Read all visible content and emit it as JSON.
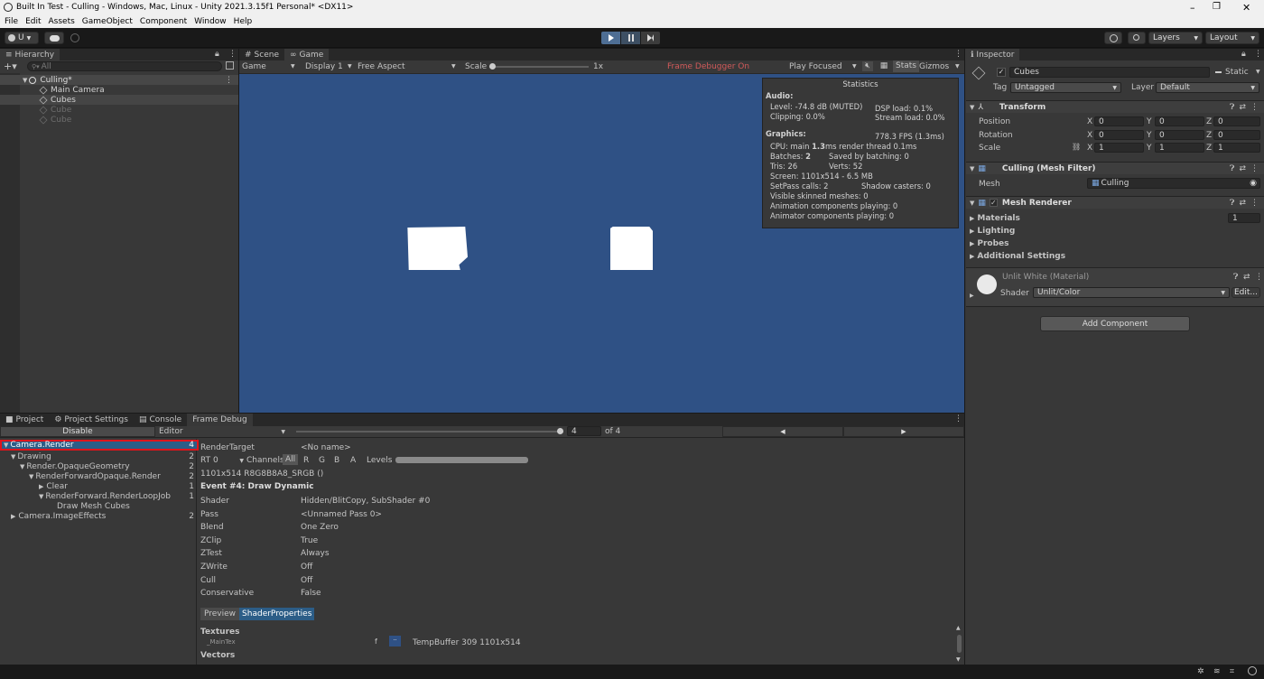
{
  "window": {
    "title": "Built In Test - Culling - Windows, Mac, Linux - Unity 2021.3.15f1 Personal* <DX11>",
    "controls": [
      "–",
      "❐",
      "✕"
    ]
  },
  "menu": [
    "File",
    "Edit",
    "Assets",
    "GameObject",
    "Component",
    "Window",
    "Help"
  ],
  "toolbar": {
    "account": "U",
    "layers": "Layers",
    "layout": "Layout"
  },
  "hierarchy": {
    "tab": "Hierarchy",
    "search_placeholder": "All",
    "scene": "Culling*",
    "items": [
      {
        "label": "Main Camera",
        "active": true
      },
      {
        "label": "Cubes",
        "active": true
      },
      {
        "label": "Cube",
        "active": false
      },
      {
        "label": "Cube",
        "active": false
      }
    ]
  },
  "scene_tabs": {
    "scene": "Scene",
    "game": "Game",
    "game_bar": {
      "mode": "Game",
      "display": "Display 1",
      "aspect": "Free Aspect",
      "scale_label": "Scale",
      "scale_value": "1x",
      "frame_debugger": "Frame Debugger On",
      "play_focused": "Play Focused",
      "stats": "Stats",
      "gizmos": "Gizmos"
    }
  },
  "stats": {
    "title": "Statistics",
    "audio_header": "Audio:",
    "level": "Level: -74.8 dB (MUTED)",
    "dsp": "DSP load: 0.1%",
    "clipping": "Clipping: 0.0%",
    "stream": "Stream load: 0.0%",
    "graphics_header": "Graphics:",
    "fps": "778.3 FPS (1.3ms)",
    "cpu_prefix": "CPU: main ",
    "cpu_main": "1.3",
    "cpu_suffix": "ms  render thread 0.1ms",
    "batches_prefix": "Batches: ",
    "batches": "2",
    "saved": "Saved by batching: 0",
    "tris": "Tris: 26",
    "verts": "Verts: 52",
    "screen": "Screen: 1101x514 - 6.5 MB",
    "setpass": "SetPass calls: 2",
    "shadow": "Shadow casters: 0",
    "skinned": "Visible skinned meshes: 0",
    "anim": "Animation components playing: 0",
    "animator": "Animator components playing: 0"
  },
  "inspector": {
    "tab": "Inspector",
    "object_name": "Cubes",
    "static": "Static",
    "tag_label": "Tag",
    "tag": "Untagged",
    "layer_label": "Layer",
    "layer": "Default",
    "transform": {
      "title": "Transform",
      "position_label": "Position",
      "rotation_label": "Rotation",
      "scale_label": "Scale",
      "position": [
        "0",
        "0",
        "0"
      ],
      "rotation": [
        "0",
        "0",
        "0"
      ],
      "scale": [
        "1",
        "1",
        "1"
      ],
      "axis": [
        "X",
        "Y",
        "Z"
      ]
    },
    "mesh_filter": {
      "title": "Culling (Mesh Filter)",
      "mesh_label": "Mesh",
      "mesh": "Culling"
    },
    "mesh_renderer": {
      "title": "Mesh Renderer",
      "materials": "Materials",
      "materials_count": "1",
      "lighting": "Lighting",
      "probes": "Probes",
      "additional": "Additional Settings"
    },
    "material": {
      "name": "Unlit White (Material)",
      "shader_label": "Shader",
      "shader": "Unlit/Color",
      "edit": "Edit..."
    },
    "add_component": "Add Component"
  },
  "bottom_tabs": {
    "project": "Project",
    "project_settings": "Project Settings",
    "console": "Console",
    "frame_debug": "Frame Debug"
  },
  "frame_debug": {
    "disable": "Disable",
    "editor": "Editor",
    "event_value": "4",
    "of_total": "of 4",
    "tree": [
      {
        "label": "Camera.Render",
        "count": "4"
      },
      {
        "label": "Drawing",
        "count": "2"
      },
      {
        "label": "Render.OpaqueGeometry",
        "count": "2"
      },
      {
        "label": "RenderForwardOpaque.Render",
        "count": "2"
      },
      {
        "label": "Clear",
        "count": "1"
      },
      {
        "label": "RenderForward.RenderLoopJob",
        "count": "1"
      },
      {
        "label": "Draw Mesh Cubes",
        "count": ""
      },
      {
        "label": "Camera.ImageEffects",
        "count": "2"
      }
    ],
    "render_target_label": "RenderTarget",
    "render_target": "<No name>",
    "rt": "RT 0",
    "channels": "Channels",
    "channel_options": [
      "All",
      "R",
      "G",
      "B",
      "A"
    ],
    "levels": "Levels",
    "format": "1101x514 R8G8B8A8_SRGB ()",
    "event_title": "Event #4: Draw Dynamic",
    "props": [
      {
        "k": "Shader",
        "v": "Hidden/BlitCopy, SubShader #0"
      },
      {
        "k": "Pass",
        "v": "<Unnamed Pass 0>"
      },
      {
        "k": "Blend",
        "v": "One Zero"
      },
      {
        "k": "ZClip",
        "v": "True"
      },
      {
        "k": "ZTest",
        "v": "Always"
      },
      {
        "k": "ZWrite",
        "v": "Off"
      },
      {
        "k": "Cull",
        "v": "Off"
      },
      {
        "k": "Conservative",
        "v": "False"
      }
    ],
    "preview_tab": "Preview",
    "shader_props_tab": "ShaderProperties",
    "textures": "Textures",
    "maintex": "_MainTex",
    "maintex_stage": "f",
    "maintex_value": "TempBuffer 309 1101x514",
    "vectors": "Vectors"
  },
  "colors": {
    "game_bg": "#2f5185",
    "selection": "#2c5d87",
    "highlight_border": "#e0141b",
    "accent": "#4c7eff"
  }
}
